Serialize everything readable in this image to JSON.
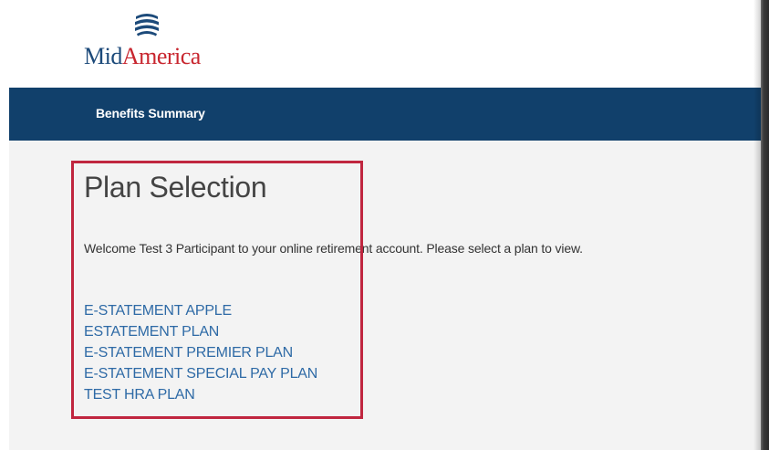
{
  "header": {
    "logo": {
      "text_mid": "Mid",
      "text_america": "America",
      "mark": "wave-stripes-logo-icon"
    }
  },
  "nav": {
    "items": [
      {
        "label": "Benefits Summary"
      }
    ]
  },
  "main": {
    "title": "Plan Selection",
    "welcome_text": "Welcome Test 3 Participant to your online retirement account. Please select a plan to view.",
    "plans": [
      {
        "label": "E-STATEMENT APPLE"
      },
      {
        "label": "ESTATEMENT PLAN"
      },
      {
        "label": "E-STATEMENT PREMIER PLAN"
      },
      {
        "label": "E-STATEMENT SPECIAL PAY PLAN"
      },
      {
        "label": "TEST HRA PLAN"
      }
    ]
  },
  "colors": {
    "navbar": "#11406b",
    "link": "#2e6aa6",
    "highlight": "#c0263f",
    "brand_blue": "#1c4a7a",
    "brand_red": "#c8262f"
  }
}
